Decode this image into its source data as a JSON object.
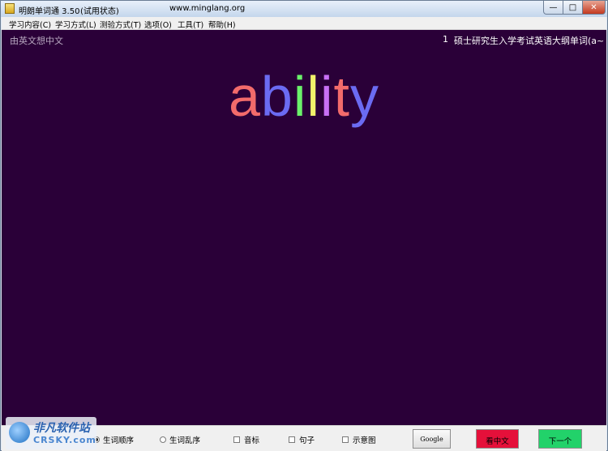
{
  "window": {
    "app_name": "明朗单词通 3.50",
    "state": "(试用状态)",
    "url": "www.minglang.org",
    "min_glyph": "—",
    "max_glyph": "□",
    "close_glyph": "✕"
  },
  "menu": {
    "items": [
      "学习内容(C)",
      "学习方式(L)",
      "测验方式(T)",
      "选项(O)",
      "工具(T)",
      "帮助(H)"
    ]
  },
  "content": {
    "mode_label": "由英文想中文",
    "word_index": "1",
    "book_title": "硕士研究生入学考试英语大纲单词(a~) 第",
    "word_letters": [
      {
        "char": "a",
        "color": "#f26b6b"
      },
      {
        "char": "b",
        "color": "#6b6bf2"
      },
      {
        "char": "i",
        "color": "#6bf26b"
      },
      {
        "char": "l",
        "color": "#f2f26b"
      },
      {
        "char": "i",
        "color": "#c870f5"
      },
      {
        "char": "t",
        "color": "#f26b6b"
      },
      {
        "char": "y",
        "color": "#6b6bf2"
      }
    ]
  },
  "bottom": {
    "radio_1_label": "生词顺序",
    "radio_2_label": "生词乱序",
    "check_phonetic": "音标",
    "check_sentence": "句子",
    "check_diagram": "示意图",
    "google_label": "Google",
    "chinese_label": "看中文",
    "next_label": "下一个"
  },
  "watermark": {
    "name": "非凡软件站",
    "domain": "CRSKY.com"
  }
}
